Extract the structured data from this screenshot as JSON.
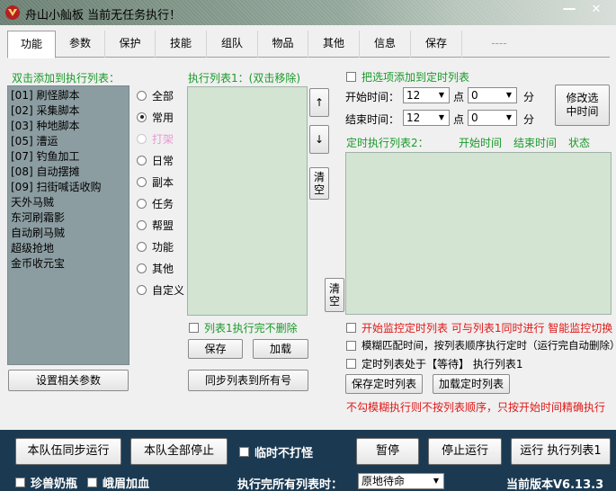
{
  "window": {
    "title": "舟山小舢板  当前无任务执行！"
  },
  "tabs": [
    {
      "label": "功能",
      "active": true
    },
    {
      "label": "参数"
    },
    {
      "label": "保护"
    },
    {
      "label": "技能"
    },
    {
      "label": "组队"
    },
    {
      "label": "物品"
    },
    {
      "label": "其他"
    },
    {
      "label": "信息"
    },
    {
      "label": "保存"
    },
    {
      "label": "----",
      "dim": true
    }
  ],
  "left": {
    "header": "双击添加到执行列表：",
    "scripts": [
      "[01] 刷怪脚本",
      "[02] 采集脚本",
      "[03] 种地脚本",
      "[05] 漕运",
      "[07] 钓鱼加工",
      "[08] 自动摆摊",
      "[09] 扫街喊话收购",
      "天外马贼",
      "东河刷霜影",
      "自动刷马贼",
      "超级抢地",
      "金币收元宝"
    ],
    "settings_button": "设置相关参数"
  },
  "categories": [
    {
      "label": "全部",
      "selected": false
    },
    {
      "label": "常用",
      "selected": true
    },
    {
      "label": "打架",
      "selected": false,
      "disabled": true
    },
    {
      "label": "日常",
      "selected": false
    },
    {
      "label": "副本",
      "selected": false
    },
    {
      "label": "任务",
      "selected": false
    },
    {
      "label": "帮盟",
      "selected": false
    },
    {
      "label": "功能",
      "selected": false
    },
    {
      "label": "其他",
      "selected": false
    },
    {
      "label": "自定义",
      "selected": false
    }
  ],
  "exec_list1": {
    "header": "执行列表1：(双击移除)",
    "up": "↑",
    "down": "↓",
    "clear": "清\n空",
    "no_delete_checkbox": "列表1执行完不删除",
    "save_button": "保存",
    "load_button": "加载",
    "sync_button": "同步列表到所有号"
  },
  "timer": {
    "add_checkbox": "把选项添加到定时列表",
    "start_label": "开始时间：",
    "end_label": "结束时间：",
    "start_hour": "12",
    "start_min": "0",
    "end_hour": "12",
    "end_min": "0",
    "hour_unit": "点",
    "min_unit": "分",
    "modify_button": "修改选中时间",
    "list2_header": "定时执行列表2：",
    "col_start": "开始时间",
    "col_end": "结束时间",
    "col_status": "状态",
    "clear2": "清\n空",
    "opt1": "开始监控定时列表  可与列表1同时进行  智能监控切换",
    "opt2": "模糊匹配时间，按列表顺序执行定时（运行完自动删除）",
    "opt3": "定时列表处于【等待】 执行列表1",
    "save_timer": "保存定时列表",
    "load_timer": "加载定时列表",
    "note": "不勾模糊执行则不按列表顺序，只按开始时间精确执行"
  },
  "bottom": {
    "sync_run": "本队伍同步运行",
    "stop_all": "本队全部停止",
    "no_fight": "临时不打怪",
    "pause": "暂停",
    "stop_run": "停止运行",
    "run_list1": "运行 执行列表1",
    "opt_a": "珍兽奶瓶",
    "opt_b": "峨眉加血",
    "after_label": "执行完所有列表时：",
    "after_value": "原地待命",
    "version": "当前版本V6.13.3"
  },
  "colors": {
    "list_bg": "#d3e4d2",
    "script_list_bg": "#8c9da2",
    "accent_green": "#1a9a2a",
    "warning_red": "#e01818",
    "bottom_bar": "#1b3a52"
  }
}
